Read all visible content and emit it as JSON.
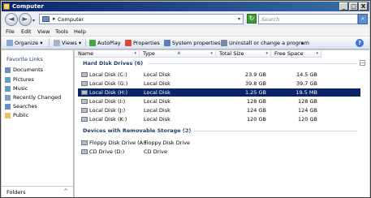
{
  "window": {
    "title": "Computer"
  },
  "caption_buttons": {
    "minimize": "_",
    "maximize": "□",
    "close": "X"
  },
  "address": {
    "location": "Computer",
    "search_placeholder": "Search",
    "back": "◄",
    "forward": "►"
  },
  "menu": {
    "items": [
      "File",
      "Edit",
      "View",
      "Tools",
      "Help"
    ]
  },
  "toolbar": {
    "organize": "Organize",
    "views": "Views",
    "autoplay": "AutoPlay",
    "properties": "Properties",
    "system_properties": "System properties",
    "uninstall": "Uninstall or change a program",
    "more": "»",
    "help": "?"
  },
  "navpane": {
    "title": "Favorite Links",
    "items": [
      "Documents",
      "Pictures",
      "Music",
      "Recently Changed",
      "Searches",
      "Public"
    ],
    "folders_label": "Folders",
    "folders_chevron": "^"
  },
  "columns": {
    "name": "Name",
    "type": "Type",
    "total_size": "Total Size",
    "free_space": "Free Space"
  },
  "groups": [
    {
      "title": "Hard Disk Drives (6)",
      "rows": [
        {
          "name": "Local Disk (C:)",
          "type": "Local Disk",
          "total": "23.9 GB",
          "free": "14.5 GB",
          "selected": false
        },
        {
          "name": "Local Disk (G:)",
          "type": "Local Disk",
          "total": "39.8 GB",
          "free": "39.7 GB",
          "selected": false
        },
        {
          "name": "Local Disk (H:)",
          "type": "Local Disk",
          "total": "1.25 GB",
          "free": "19.5 MB",
          "selected": true
        },
        {
          "name": "Local Disk (I:)",
          "type": "Local Disk",
          "total": "128 GB",
          "free": "128 GB",
          "selected": false
        },
        {
          "name": "Local Disk (J:)",
          "type": "Local Disk",
          "total": "124 GB",
          "free": "124 GB",
          "selected": false
        },
        {
          "name": "Local Disk (K:)",
          "type": "Local Disk",
          "total": "120 GB",
          "free": "120 GB",
          "selected": false
        }
      ]
    },
    {
      "title": "Devices with Removable Storage (2)",
      "rows": [
        {
          "name": "Floppy Disk Drive (A:)",
          "type": "Floppy Disk Drive",
          "total": "",
          "free": "",
          "selected": false
        },
        {
          "name": "CD Drive (D:)",
          "type": "CD Drive",
          "total": "",
          "free": "",
          "selected": false
        }
      ]
    }
  ],
  "colors": {
    "selection": "#0a246a",
    "group_title": "#1e3b6b",
    "titlebar_start": "#0a246a",
    "titlebar_end": "#3a6ea5"
  }
}
